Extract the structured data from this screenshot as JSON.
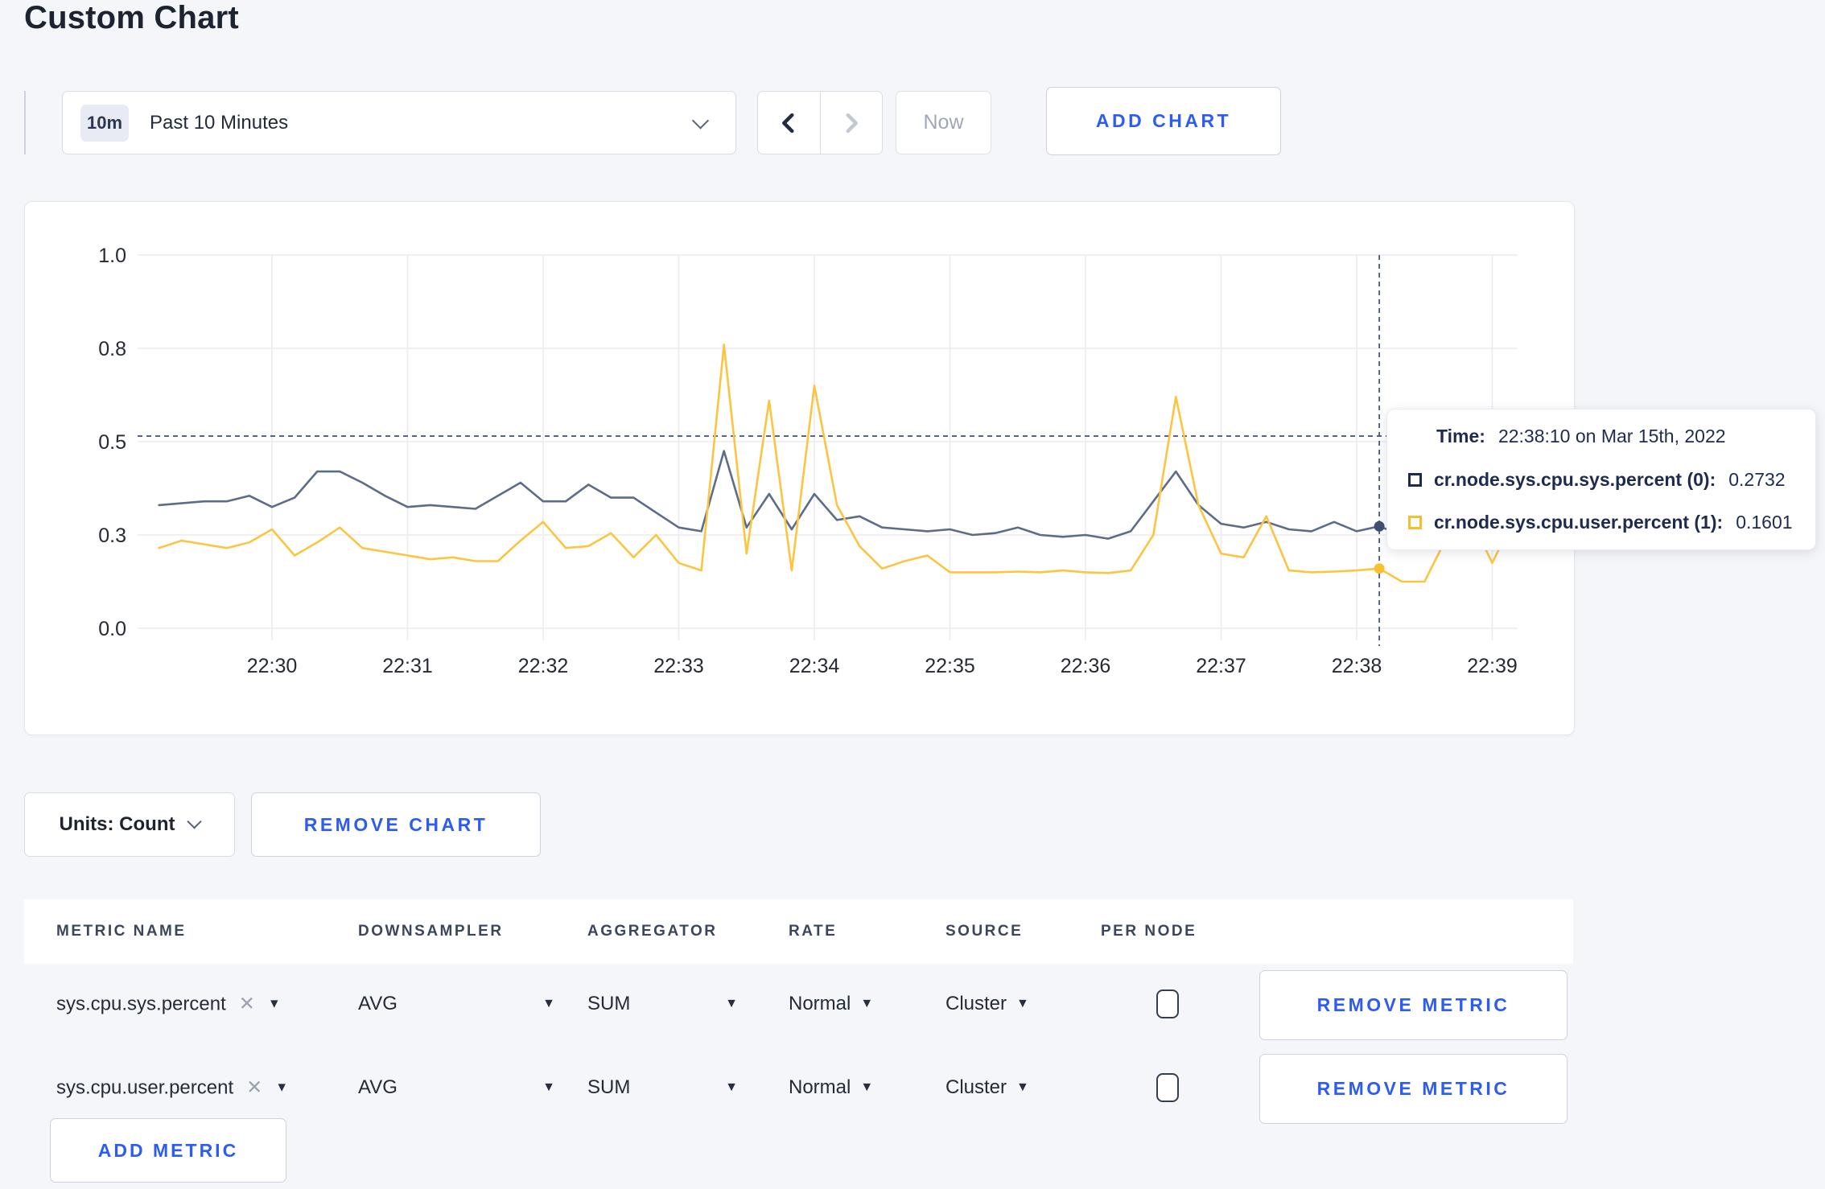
{
  "page": {
    "title": "Custom Chart"
  },
  "toolbar": {
    "range_badge": "10m",
    "range_label": "Past 10 Minutes",
    "back_icon": "chevron-left",
    "forward_icon": "chevron-right",
    "now_label": "Now",
    "add_chart_label": "ADD CHART"
  },
  "chart_data": {
    "type": "line",
    "title": "",
    "xlabel": "",
    "ylabel": "",
    "grid": true,
    "legend_position": "tooltip-on-hover",
    "x_axis": {
      "start_time": "22:29:10",
      "step_seconds": 10,
      "tick_labels": [
        "22:30",
        "22:31",
        "22:32",
        "22:33",
        "22:34",
        "22:35",
        "22:36",
        "22:37",
        "22:38",
        "22:39"
      ]
    },
    "y_axis": {
      "range": [
        0,
        1
      ],
      "ticks": [
        0,
        0.25,
        0.5,
        0.75,
        1
      ],
      "tick_labels": [
        "0.0",
        "0.3",
        "0.5",
        "0.8",
        "1.0"
      ]
    },
    "series": [
      {
        "name": "cr.node.sys.cpu.sys.percent (0)",
        "color": "#5d6c88",
        "swatch_color": "#1d2b4d",
        "values": [
          0.33,
          0.335,
          0.34,
          0.34,
          0.355,
          0.325,
          0.35,
          0.42,
          0.42,
          0.39,
          0.355,
          0.325,
          0.33,
          0.325,
          0.32,
          0.355,
          0.39,
          0.34,
          0.34,
          0.385,
          0.35,
          0.35,
          0.31,
          0.27,
          0.26,
          0.475,
          0.27,
          0.36,
          0.265,
          0.36,
          0.29,
          0.3,
          0.27,
          0.265,
          0.26,
          0.265,
          0.25,
          0.255,
          0.27,
          0.25,
          0.245,
          0.25,
          0.24,
          0.26,
          0.34,
          0.42,
          0.33,
          0.28,
          0.27,
          0.285,
          0.265,
          0.26,
          0.285,
          0.26,
          0.2732,
          0.25,
          0.26,
          0.27,
          0.27,
          0.275,
          0.28
        ]
      },
      {
        "name": "cr.node.sys.cpu.user.percent (1)",
        "color": "#fbc542",
        "swatch_color": "#f5be2d",
        "values": [
          0.215,
          0.235,
          0.225,
          0.215,
          0.23,
          0.265,
          0.195,
          0.23,
          0.27,
          0.215,
          0.205,
          0.195,
          0.185,
          0.19,
          0.18,
          0.18,
          0.235,
          0.285,
          0.215,
          0.22,
          0.255,
          0.19,
          0.25,
          0.175,
          0.155,
          0.76,
          0.2,
          0.61,
          0.155,
          0.65,
          0.33,
          0.22,
          0.16,
          0.18,
          0.195,
          0.15,
          0.15,
          0.15,
          0.152,
          0.15,
          0.155,
          0.15,
          0.148,
          0.155,
          0.25,
          0.62,
          0.33,
          0.2,
          0.19,
          0.3,
          0.155,
          0.15,
          0.152,
          0.155,
          0.1601,
          0.125,
          0.125,
          0.245,
          0.3,
          0.175,
          0.3
        ]
      }
    ],
    "hover": {
      "index": 54,
      "time": "22:38:10",
      "crosshair_y_value": 0.515,
      "dot_values": [
        0.2732,
        0.1601
      ],
      "dot_colors": [
        "#3f4f70",
        "#f7c22f"
      ]
    }
  },
  "tooltip": {
    "time_label": "Time:",
    "time_value": "22:38:10 on Mar 15th, 2022",
    "rows": [
      {
        "label": "cr.node.sys.cpu.sys.percent (0):",
        "value": "0.2732"
      },
      {
        "label": "cr.node.sys.cpu.user.percent (1):",
        "value": "0.1601"
      }
    ]
  },
  "units": {
    "label": "Units: Count",
    "remove_chart_label": "REMOVE CHART"
  },
  "metrics_table": {
    "headers": [
      "METRIC NAME",
      "DOWNSAMPLER",
      "AGGREGATOR",
      "RATE",
      "SOURCE",
      "PER NODE"
    ],
    "rows": [
      {
        "name": "sys.cpu.sys.percent",
        "downsampler": "AVG",
        "aggregator": "SUM",
        "rate": "Normal",
        "source": "Cluster",
        "per_node_checked": false,
        "remove_label": "REMOVE METRIC"
      },
      {
        "name": "sys.cpu.user.percent",
        "downsampler": "AVG",
        "aggregator": "SUM",
        "rate": "Normal",
        "source": "Cluster",
        "per_node_checked": false,
        "remove_label": "REMOVE METRIC"
      }
    ],
    "add_metric_label": "ADD METRIC"
  },
  "colors": {
    "accent_blue": "#2d5cf0",
    "page_background": "#f5f6fa",
    "gridline": "#ececf0",
    "crosshair": "#4a5b7d"
  }
}
